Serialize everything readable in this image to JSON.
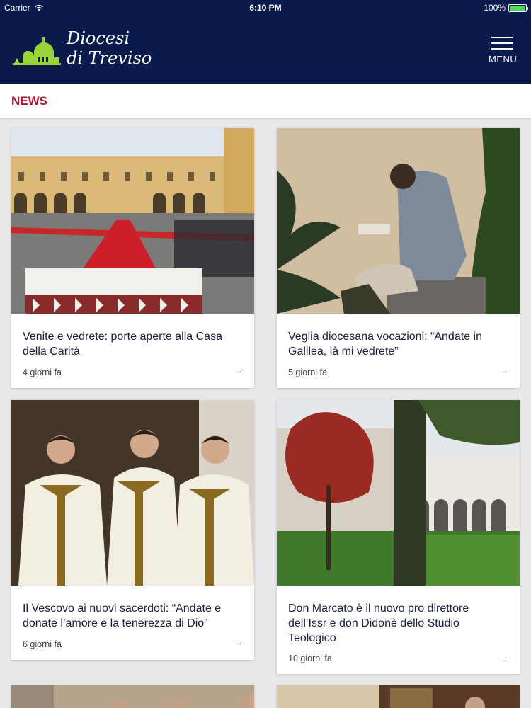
{
  "status_bar": {
    "carrier": "Carrier",
    "time": "6:10 PM",
    "battery": "100%"
  },
  "header": {
    "logo_line1": "Diocesi",
    "logo_line2": "di Treviso",
    "menu_label": "MENU"
  },
  "section": {
    "title": "NEWS"
  },
  "articles": [
    {
      "title": "Venite e vedrete: porte aperte alla Casa della Carità",
      "date": "4 giorni fa"
    },
    {
      "title": "Veglia diocesana vocazioni: “Andate in Galilea, là mi vedrete”",
      "date": "5 giorni fa"
    },
    {
      "title": "Il Vescovo ai nuovi sacerdoti: “Andate e donate l’amore e la tenerezza di Dio”",
      "date": "6 giorni fa"
    },
    {
      "title": "Don Marcato è il nuovo pro direttore dell’Issr e don Didonè dello Studio Teologico",
      "date": "10 giorni fa"
    }
  ],
  "icons": {
    "arrow": "→"
  },
  "colors": {
    "header_bg": "#0a1a4c",
    "accent": "#b0102a",
    "logo_green": "#9bd33a"
  }
}
